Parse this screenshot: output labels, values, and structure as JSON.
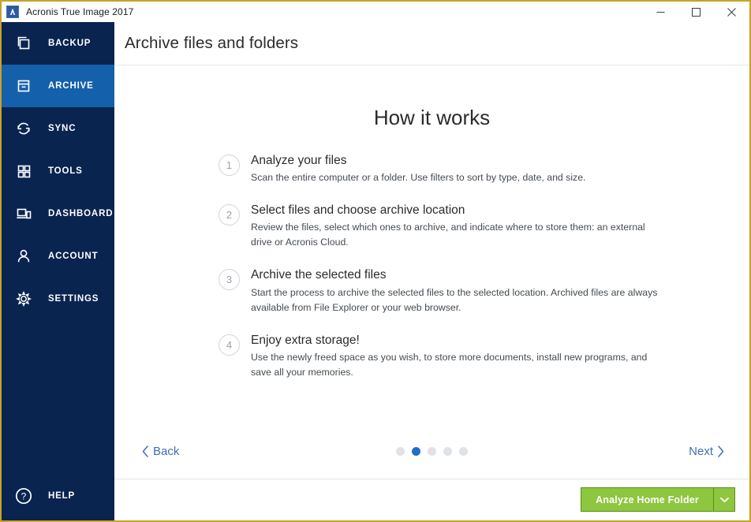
{
  "window": {
    "title": "Acronis True Image 2017",
    "logo_icon": "acronis-logo-icon",
    "controls": [
      {
        "name": "minimize",
        "icon": "minimize-icon"
      },
      {
        "name": "maximize",
        "icon": "maximize-icon"
      },
      {
        "name": "close",
        "icon": "close-icon"
      }
    ]
  },
  "sidebar": {
    "items": [
      {
        "label": "BACKUP",
        "icon": "backup-copies-icon",
        "active": false
      },
      {
        "label": "ARCHIVE",
        "icon": "archive-box-icon",
        "active": true
      },
      {
        "label": "SYNC",
        "icon": "sync-arrows-icon",
        "active": false
      },
      {
        "label": "TOOLS",
        "icon": "grid-squares-icon",
        "active": false
      },
      {
        "label": "DASHBOARD",
        "icon": "devices-icon",
        "active": false
      },
      {
        "label": "ACCOUNT",
        "icon": "person-icon",
        "active": false
      },
      {
        "label": "SETTINGS",
        "icon": "gear-icon",
        "active": false
      }
    ],
    "help": {
      "label": "HELP",
      "icon": "question-circle-icon"
    }
  },
  "header": {
    "title": "Archive files and folders"
  },
  "main": {
    "heading": "How it works",
    "steps": [
      {
        "number": "1",
        "title": "Analyze your files",
        "description": "Scan the entire computer or a folder. Use filters to sort by type, date, and size."
      },
      {
        "number": "2",
        "title": "Select files and choose archive location",
        "description": "Review the files, select which ones to archive, and indicate where to store them: an external drive or Acronis Cloud."
      },
      {
        "number": "3",
        "title": "Archive the selected files",
        "description": "Start the process to archive the selected files to the selected location. Archived files are always available from File Explorer or your web browser."
      },
      {
        "number": "4",
        "title": "Enjoy extra storage!",
        "description": "Use the newly freed space as you wish, to store more documents, install new programs, and save all your memories."
      }
    ]
  },
  "pager": {
    "back_label": "Back",
    "next_label": "Next",
    "back_icon": "chevron-left-icon",
    "next_icon": "chevron-right-icon",
    "dots_total": 5,
    "dots_active_index": 1
  },
  "footer": {
    "primary_action": "Analyze Home Folder",
    "dropdown_icon": "chevron-down-icon"
  },
  "colors": {
    "sidebar_bg": "#0a2450",
    "sidebar_active": "#1560ab",
    "accent_link": "#3d6fb5",
    "dot_active": "#1f6fc4",
    "action_green": "#8dc63f",
    "window_border": "#c9a227"
  }
}
